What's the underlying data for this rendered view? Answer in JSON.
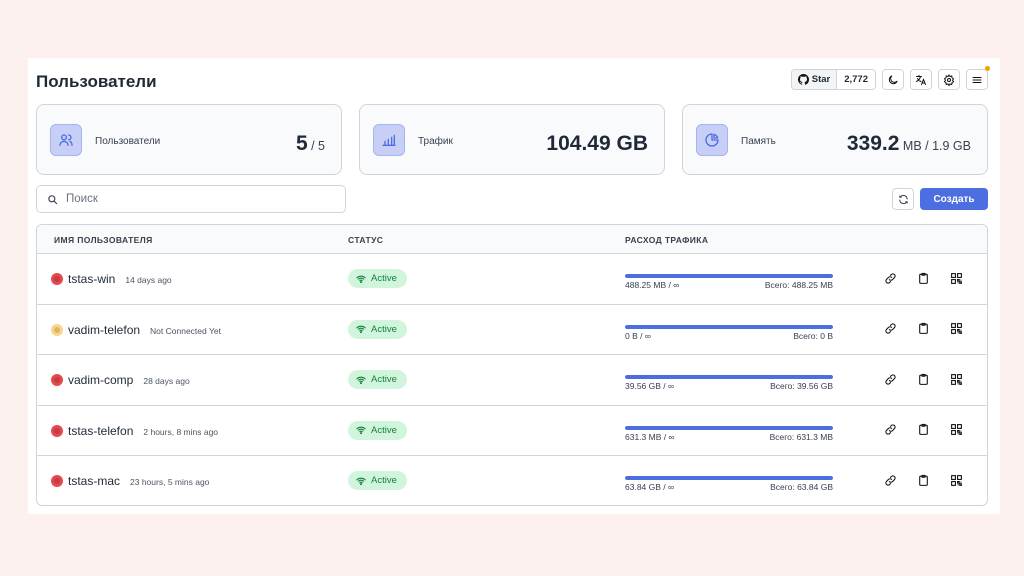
{
  "header": {
    "title": "Пользователи",
    "github_star_label": "Star",
    "github_star_count": "2,772"
  },
  "cards": [
    {
      "label": "Пользователи",
      "value": "5",
      "suffix": " / 5",
      "icon": "users-icon"
    },
    {
      "label": "Трафик",
      "value": "104.49 GB",
      "suffix": "",
      "icon": "chart-icon"
    },
    {
      "label": "Память",
      "value": "339.2",
      "suffix": " MB / 1.9 GB",
      "icon": "pie-icon"
    }
  ],
  "search": {
    "placeholder": "Поиск"
  },
  "create_label": "Создать",
  "table": {
    "headers": [
      "ИМЯ ПОЛЬЗОВАТЕЛЯ",
      "СТАТУС",
      "РАСХОД ТРАФИКА"
    ],
    "rows": [
      {
        "name": "tstas-win",
        "last_seen": "14 days ago",
        "status": "Active",
        "online_color": "#e5484d",
        "used": "488.25 MB / ∞",
        "total": "Всего: 488.25 MB",
        "fill": 1.0
      },
      {
        "name": "vadim-telefon",
        "last_seen": "Not Connected Yet",
        "status": "Active",
        "online_color": "#fcd58a",
        "used": "0 B / ∞",
        "total": "Всего: 0 B",
        "fill": 1.0
      },
      {
        "name": "vadim-comp",
        "last_seen": "28 days ago",
        "status": "Active",
        "online_color": "#e5484d",
        "used": "39.56 GB / ∞",
        "total": "Всего: 39.56 GB",
        "fill": 1.0
      },
      {
        "name": "tstas-telefon",
        "last_seen": "2 hours, 8 mins ago",
        "status": "Active",
        "online_color": "#e5484d",
        "used": "631.3 MB / ∞",
        "total": "Всего: 631.3 MB",
        "fill": 1.0
      },
      {
        "name": "tstas-mac",
        "last_seen": "23 hours, 5 mins ago",
        "status": "Active",
        "online_color": "#e5484d",
        "used": "63.84 GB / ∞",
        "total": "Всего: 63.84 GB",
        "fill": 1.0
      }
    ]
  },
  "colors": {
    "accent": "#4c6ee0",
    "active_badge_bg": "#d1f5dc",
    "active_badge_text": "#15803d",
    "notify": "#f59e0b"
  }
}
